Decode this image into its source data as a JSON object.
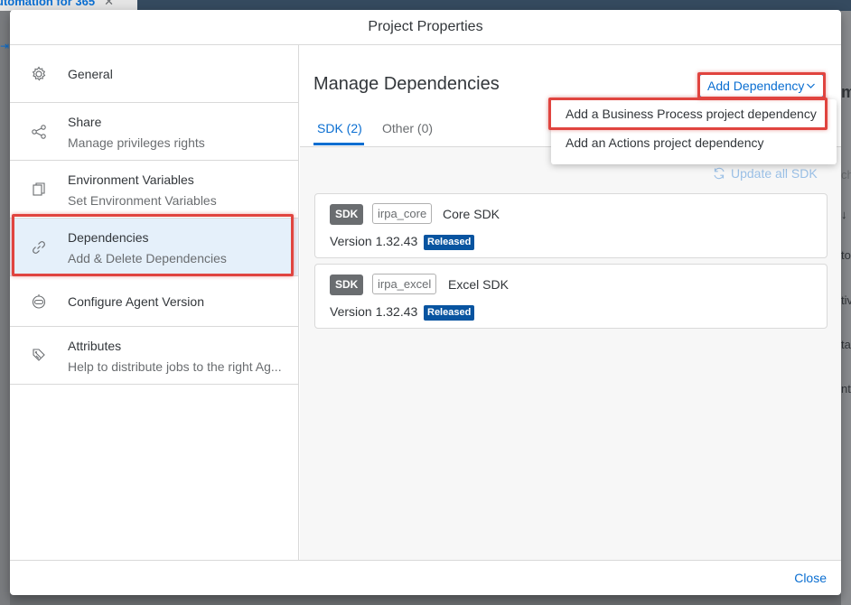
{
  "background": {
    "tab_title": "utomation for 365",
    "tab_close": "✕",
    "right_cells": [
      "m",
      "ch",
      "↓",
      "to",
      "tiv",
      "ta",
      "nt"
    ]
  },
  "dialog": {
    "title": "Project Properties",
    "close_label": "Close"
  },
  "sidebar": {
    "items": [
      {
        "title": "General",
        "subtitle": "",
        "icon": "gear-icon"
      },
      {
        "title": "Share",
        "subtitle": "Manage privileges rights",
        "icon": "share-icon"
      },
      {
        "title": "Environment Variables",
        "subtitle": "Set Environment Variables",
        "icon": "documents-icon"
      },
      {
        "title": "Dependencies",
        "subtitle": "Add & Delete Dependencies",
        "icon": "chain-link-icon"
      },
      {
        "title": "Configure Agent Version",
        "subtitle": "",
        "icon": "robot-icon"
      },
      {
        "title": "Attributes",
        "subtitle": "Help to distribute jobs to the right Ag...",
        "icon": "tags-icon"
      }
    ],
    "selected": "Dependencies"
  },
  "main": {
    "title": "Manage Dependencies",
    "add_dependency_label": "Add Dependency",
    "tabs": [
      {
        "label": "SDK (2)",
        "active": true
      },
      {
        "label": "Other (0)",
        "active": false
      }
    ],
    "update_all_label": "Update all SDK",
    "sdks": [
      {
        "badge": "SDK",
        "package": "irpa_core",
        "name": "Core SDK",
        "version": "Version 1.32.43",
        "status": "Released"
      },
      {
        "badge": "SDK",
        "package": "irpa_excel",
        "name": "Excel SDK",
        "version": "Version 1.32.43",
        "status": "Released"
      }
    ]
  },
  "dropdown": {
    "items": [
      "Add a Business Process project dependency",
      "Add an Actions project dependency"
    ]
  },
  "colors": {
    "accent": "#0a6ed1",
    "highlight": "#e0443f",
    "released_badge": "#0854a0",
    "selected_bg": "#e5f0fa"
  }
}
